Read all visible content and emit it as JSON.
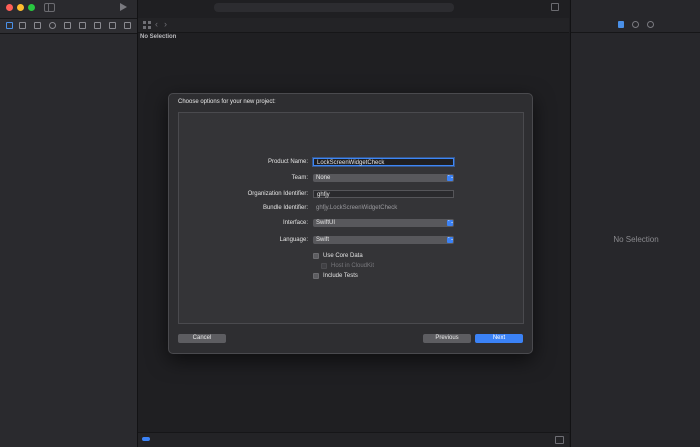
{
  "center": {
    "jump_bar_arrows": {
      "back": "‹",
      "forward": "›"
    },
    "status": "No Selection"
  },
  "inspector": {
    "status": "No Selection"
  },
  "dialog": {
    "title": "Choose options for your new project:",
    "form": {
      "product_name": {
        "label": "Product Name:",
        "value": "LockScreenWidgetCheck"
      },
      "team": {
        "label": "Team:",
        "value": "None"
      },
      "organization_identifier": {
        "label": "Organization Identifier:",
        "value": "ghfjy"
      },
      "bundle_identifier": {
        "label": "Bundle Identifier:",
        "value": "ghfjy.LockScreenWidgetCheck"
      },
      "interface": {
        "label": "Interface:",
        "value": "SwiftUI"
      },
      "language": {
        "label": "Language:",
        "value": "Swift"
      },
      "use_core_data": {
        "label": "Use Core Data",
        "checked": false
      },
      "host_in_cloudkit": {
        "label": "Host in CloudKit",
        "checked": false,
        "disabled": true
      },
      "include_tests": {
        "label": "Include Tests",
        "checked": false
      }
    },
    "buttons": {
      "cancel": "Cancel",
      "previous": "Previous",
      "next": "Next"
    },
    "popup_chevron": "⌃⌄"
  },
  "colors": {
    "accent": "#3b82f6",
    "close": "#ff5f57",
    "minimize": "#febc2e",
    "zoom": "#28c840"
  }
}
